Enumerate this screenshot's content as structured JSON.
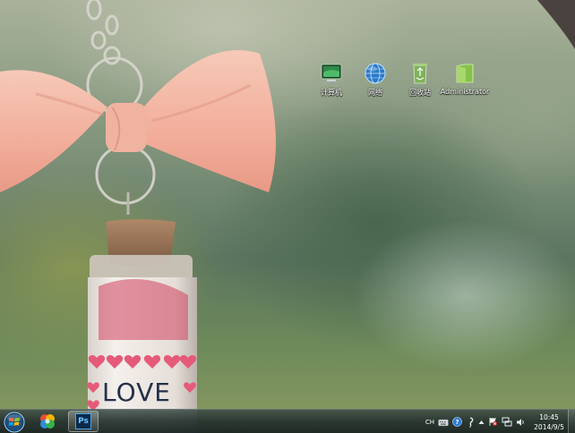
{
  "desktop": {
    "icons": [
      {
        "label": "计算机",
        "icon": "computer-icon"
      },
      {
        "label": "网络",
        "icon": "network-globe-icon"
      },
      {
        "label": "回收站",
        "icon": "recycle-bin-icon"
      },
      {
        "label": "Administrator",
        "icon": "user-folder-icon"
      }
    ],
    "wallpaper": {
      "text": "LOVE"
    }
  },
  "taskbar": {
    "start_icon": "windows-start-orb-icon",
    "pinned": [
      {
        "icon": "colorful-app-icon"
      },
      {
        "icon": "photoshop-icon",
        "label": "Ps",
        "active": true
      }
    ],
    "tray": {
      "language": "CH",
      "icons": [
        "keyboard-icon",
        "help-icon",
        "notification-area-icon",
        "show-hidden-icons-arrow",
        "action-center-flag-icon",
        "network-status-icon",
        "volume-icon"
      ],
      "time": "10:45",
      "date": "2014/9/5"
    }
  },
  "colors": {
    "taskbar_bg": "#23302d",
    "ps_blue": "#0b2a4a",
    "ribbon_pink": "#f3b9a8"
  }
}
